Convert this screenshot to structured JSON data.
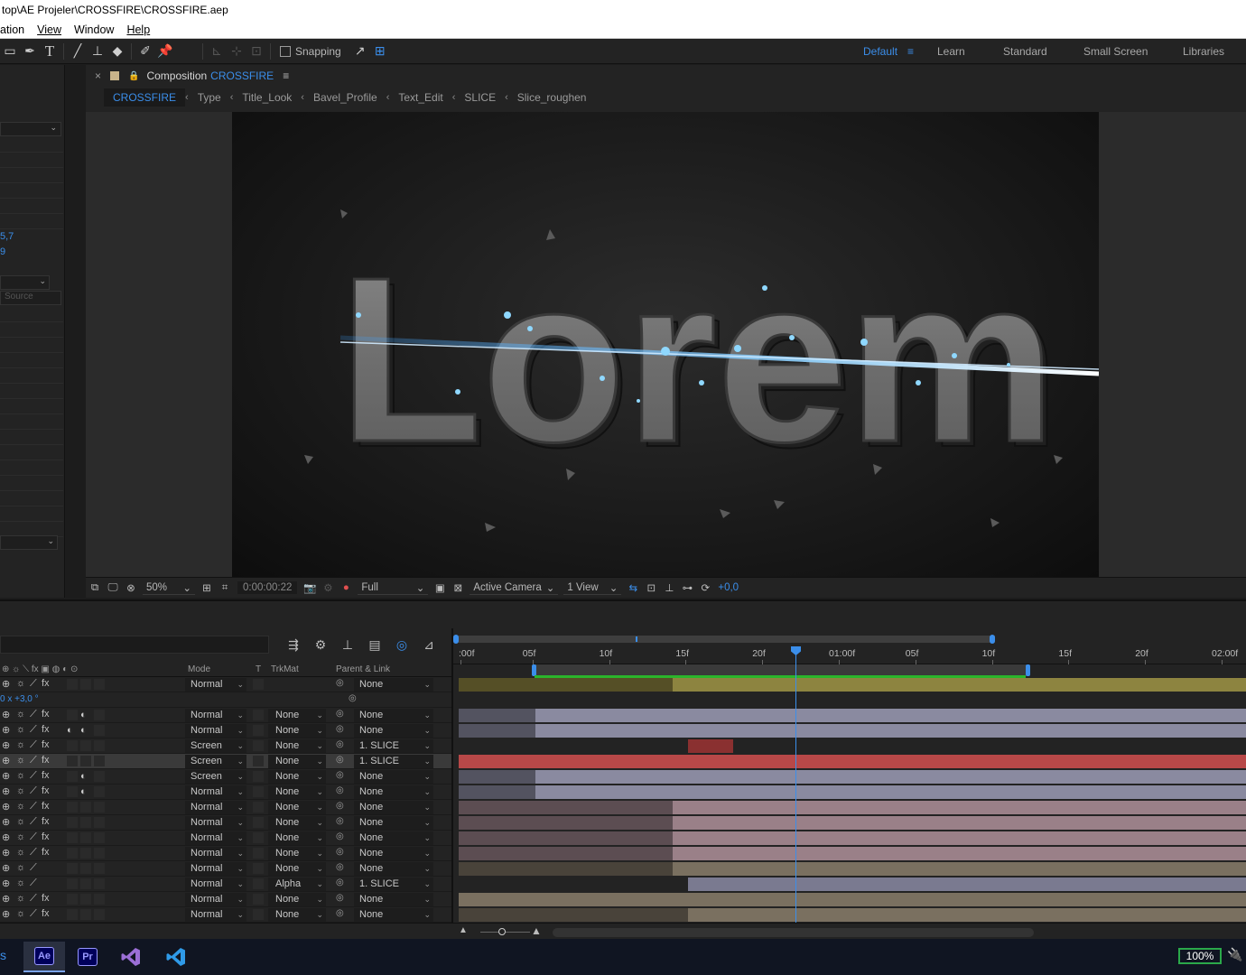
{
  "window": {
    "title": "top\\AE Projeler\\CROSSFIRE\\CROSSFIRE.aep"
  },
  "menu": [
    "ation",
    "View",
    "Window",
    "Help"
  ],
  "toolbar": {
    "snapping_label": "Snapping",
    "workspaces": [
      "Default",
      "Learn",
      "Standard",
      "Small Screen",
      "Libraries"
    ],
    "active_workspace": "Default"
  },
  "left_panel": {
    "value1": "5,7",
    "value2": "9",
    "dropdown_label": "Source"
  },
  "composition": {
    "tab_label": "Composition",
    "tab_name": "CROSSFIRE",
    "breadcrumbs": [
      "CROSSFIRE",
      "Type",
      "Title_Look",
      "Bavel_Profile",
      "Text_Edit",
      "SLICE",
      "Slice_roughen"
    ],
    "footer": {
      "zoom": "50%",
      "timecode": "0:00:00:22",
      "resolution": "Full",
      "camera": "Active Camera",
      "views": "1 View",
      "exposure": "+0,0"
    }
  },
  "timeline": {
    "headers": {
      "mode": "Mode",
      "t": "T",
      "trkmat": "TrkMat",
      "parent": "Parent & Link"
    },
    "ruler_labels": [
      ":00f",
      "05f",
      "10f",
      "15f",
      "20f",
      "01:00f",
      "05f",
      "10f",
      "15f",
      "20f",
      "02:00f"
    ],
    "first_row_value": "0 x +3,0 °",
    "layers": [
      {
        "mode": "Normal",
        "trkmat": "",
        "parent": "None",
        "bar_color": "#8d8440",
        "bar_start": 0.0,
        "bar_dim_end": 2.8
      },
      {
        "mode": "",
        "trkmat": "",
        "parent": "",
        "bar_color": "",
        "bar_start": 0,
        "bar_dim_end": 0
      },
      {
        "mode": "Normal",
        "trkmat": "None",
        "parent": "None",
        "bar_color": "#8a8aa0",
        "bar_start": 0.0,
        "bar_dim_end": 1.0
      },
      {
        "mode": "Normal",
        "trkmat": "None",
        "parent": "None",
        "bar_color": "#8a8aa0",
        "bar_start": 0.0,
        "bar_dim_end": 1.0
      },
      {
        "mode": "Screen",
        "trkmat": "None",
        "parent": "1. SLICE",
        "bar_color": "#8a3030",
        "bar_start": 3.0,
        "bar_dim_end": 3.0
      },
      {
        "mode": "Screen",
        "trkmat": "None",
        "parent": "1. SLICE",
        "bar_color": "#b84848",
        "bar_start": 0.0,
        "bar_dim_end": 0.0
      },
      {
        "mode": "Screen",
        "trkmat": "None",
        "parent": "None",
        "bar_color": "#8a8aa0",
        "bar_start": 0.0,
        "bar_dim_end": 1.0
      },
      {
        "mode": "Normal",
        "trkmat": "None",
        "parent": "None",
        "bar_color": "#8a8aa0",
        "bar_start": 0.0,
        "bar_dim_end": 1.0
      },
      {
        "mode": "Normal",
        "trkmat": "None",
        "parent": "None",
        "bar_color": "#9a8088",
        "bar_start": 0.0,
        "bar_dim_end": 2.8
      },
      {
        "mode": "Normal",
        "trkmat": "None",
        "parent": "None",
        "bar_color": "#9a8088",
        "bar_start": 0.0,
        "bar_dim_end": 2.8
      },
      {
        "mode": "Normal",
        "trkmat": "None",
        "parent": "None",
        "bar_color": "#9a8088",
        "bar_start": 0.0,
        "bar_dim_end": 2.8
      },
      {
        "mode": "Normal",
        "trkmat": "None",
        "parent": "None",
        "bar_color": "#9a8088",
        "bar_start": 0.0,
        "bar_dim_end": 2.8
      },
      {
        "mode": "Normal",
        "trkmat": "None",
        "parent": "None",
        "bar_color": "#7a7060",
        "bar_start": 0.0,
        "bar_dim_end": 2.8
      },
      {
        "mode": "Normal",
        "trkmat": "Alpha",
        "parent": "1. SLICE",
        "bar_color": "#7a7a90",
        "bar_start": 3.0,
        "bar_dim_end": 3.0
      },
      {
        "mode": "Normal",
        "trkmat": "None",
        "parent": "None",
        "bar_color": "#7a7060",
        "bar_start": 0.0,
        "bar_dim_end": 0.0
      },
      {
        "mode": "Normal",
        "trkmat": "None",
        "parent": "None",
        "bar_color": "#7a7060",
        "bar_start": 0.0,
        "bar_dim_end": 3.0
      }
    ]
  },
  "taskbar": {
    "apps": [
      "Ae",
      "Pr"
    ],
    "battery": "100%"
  },
  "viewer_text": "Lorem",
  "colors": {
    "accent": "#3b8eea",
    "green": "#2bb52b"
  }
}
